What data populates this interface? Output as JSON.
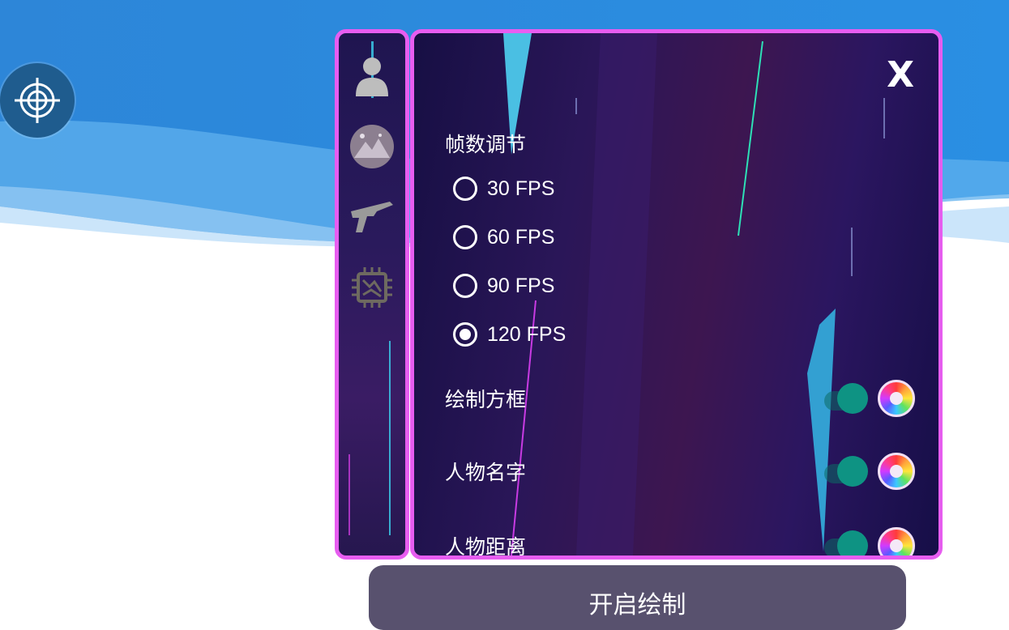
{
  "panel": {
    "close_label": "X",
    "section_title": "帧数调节",
    "fps_options": [
      "30 FPS",
      "60 FPS",
      "90 FPS",
      "120 FPS"
    ],
    "fps_selected": "120 FPS",
    "toggles": [
      {
        "label": "绘制方框",
        "enabled": true
      },
      {
        "label": "人物名字",
        "enabled": true
      },
      {
        "label": "人物距离",
        "enabled": true
      }
    ]
  },
  "side_tabs": [
    "player-icon",
    "landscape-icon",
    "rifle-icon",
    "chip-icon"
  ],
  "floating_button_icon": "crosshair-icon",
  "bottom_button": {
    "label": "开启绘制"
  },
  "colors": {
    "accent_border": "#e75df0",
    "panel_bg": "#1d1250",
    "toggle_on": "#0e9383",
    "button_bg": "#58516e"
  }
}
